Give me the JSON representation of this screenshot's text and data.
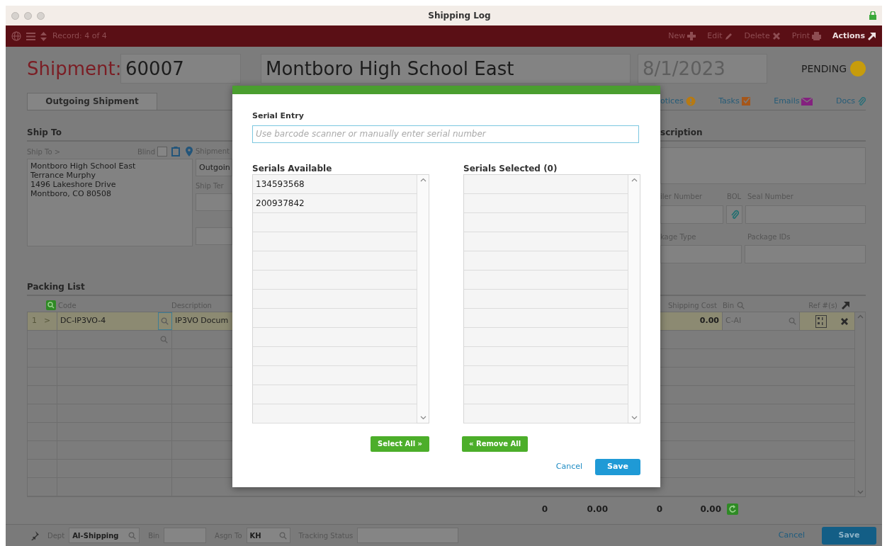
{
  "window": {
    "title": "Shipping Log"
  },
  "toolbar": {
    "record": "Record: 4 of 4",
    "actions": [
      {
        "label": "New",
        "kind": "plus",
        "disabled": true
      },
      {
        "label": "Edit",
        "kind": "pencil",
        "disabled": true
      },
      {
        "label": "Delete",
        "kind": "cross",
        "disabled": true
      },
      {
        "label": "Print",
        "kind": "printer",
        "disabled": true
      },
      {
        "label": "Actions",
        "kind": "arrow",
        "disabled": false
      }
    ]
  },
  "header": {
    "label": "Shipment:",
    "number": "60007",
    "customer": "Montboro High School East",
    "date": "8/1/2023",
    "status": "PENDING"
  },
  "tabs": [
    {
      "label": "Outgoing Shipment",
      "selected": true
    }
  ],
  "links": [
    {
      "label": "otices",
      "kind": "alert"
    },
    {
      "label": "Tasks",
      "kind": "check"
    },
    {
      "label": "Emails",
      "kind": "mail"
    },
    {
      "label": "Docs",
      "kind": "clip"
    }
  ],
  "ship_to": {
    "heading": "Ship To",
    "link": "Ship To >",
    "blind_label": "Blind",
    "blind_checked": false,
    "address": "Montboro High School East\nTerrance Murphy\n1496 Lakeshore Drive\nMontboro, CO 80508",
    "shipment_label": "Shipment",
    "shipment_value": "Outgoin",
    "terms_label": "Ship Ter"
  },
  "description": {
    "heading": "scription",
    "trailer_label": "iler Number",
    "bol_label": "BOL",
    "seal_label": "Seal Number",
    "package_type_label": "kage Type",
    "package_ids_label": "Package IDs"
  },
  "packing_list": {
    "heading": "Packing List",
    "columns": {
      "code": "Code",
      "description": "Description",
      "shipping_cost": "Shipping Cost",
      "bin": "Bin",
      "refs": "Ref #(s)"
    },
    "rows": [
      {
        "number": "1",
        "marker": ">",
        "code": "DC-IP3VO-4",
        "description": "IP3VO Docum",
        "shipping_cost": "0.00",
        "bin": "C-AI",
        "selected": true
      }
    ],
    "totals": [
      "0",
      "0.00",
      "0",
      "0.00"
    ]
  },
  "footer": {
    "dept_label": "Dept",
    "dept": "AI-Shipping",
    "bin_label": "Bin",
    "assign_label": "Asgn To",
    "assign": "KH",
    "tracking_label": "Tracking Status",
    "cancel": "Cancel",
    "save": "Save"
  },
  "dialog": {
    "entry": {
      "label": "Serial Entry",
      "placeholder": "Use barcode scanner or manually enter serial number"
    },
    "available_heading": "Serials Available",
    "available": [
      "134593568",
      "200937842"
    ],
    "selected_heading": "Serials Selected (0)",
    "select_all": "Select All »",
    "remove_all": "« Remove All",
    "cancel": "Cancel",
    "save": "Save"
  }
}
